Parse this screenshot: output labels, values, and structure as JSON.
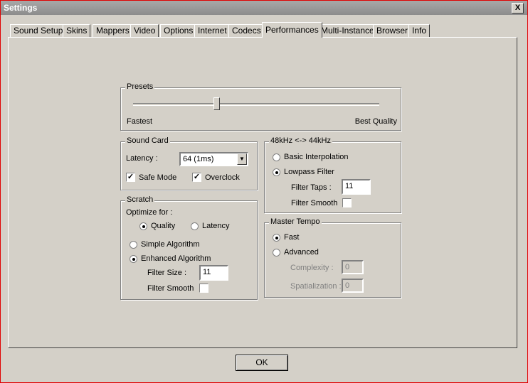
{
  "window": {
    "title": "Settings",
    "close_glyph": "X"
  },
  "tabs": [
    {
      "label": "Sound Setup"
    },
    {
      "label": "Skins"
    },
    {
      "label": "Mappers"
    },
    {
      "label": "Video"
    },
    {
      "label": "Options"
    },
    {
      "label": "Internet"
    },
    {
      "label": "Codecs"
    },
    {
      "label": "Performances",
      "active": true
    },
    {
      "label": "Multi-Instance"
    },
    {
      "label": "Browser"
    },
    {
      "label": "Info"
    }
  ],
  "presets": {
    "title": "Presets",
    "min_label": "Fastest",
    "max_label": "Best Quality",
    "value_fraction": 0.34
  },
  "sound_card": {
    "title": "Sound Card",
    "latency_label": "Latency :",
    "latency_value": "64 (1ms)",
    "safe_mode_label": "Safe Mode",
    "safe_mode_checked": true,
    "overclock_label": "Overclock",
    "overclock_checked": true
  },
  "scratch": {
    "title": "Scratch",
    "optimize_label": "Optimize for :",
    "quality_label": "Quality",
    "latency_label": "Latency",
    "simple_label": "Simple Algorithm",
    "enhanced_label": "Enhanced Algorithm",
    "filter_size_label": "Filter Size :",
    "filter_size_value": "11",
    "filter_smooth_label": "Filter Smooth"
  },
  "resample": {
    "title": "48kHz <-> 44kHz",
    "basic_label": "Basic Interpolation",
    "lowpass_label": "Lowpass Filter",
    "filter_taps_label": "Filter Taps :",
    "filter_taps_value": "11",
    "filter_smooth_label": "Filter Smooth"
  },
  "master_tempo": {
    "title": "Master Tempo",
    "fast_label": "Fast",
    "advanced_label": "Advanced",
    "complexity_label": "Complexity :",
    "complexity_value": "0",
    "spatialization_label": "Spatialization :",
    "spatialization_value": "0"
  },
  "buttons": {
    "ok_label": "OK"
  }
}
